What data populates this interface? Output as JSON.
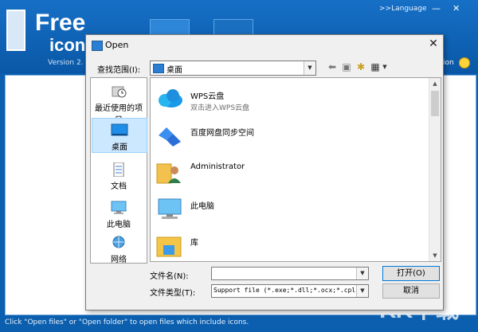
{
  "app": {
    "logo_line1": "Free",
    "logo_line2": "icon",
    "version": "Version 2.",
    "language": ">>Language",
    "right_text": "ation",
    "status": "Click \"Open files\" or \"Open folder\" to open files which include icons.",
    "watermark": "KK下载"
  },
  "dialog": {
    "title": "Open",
    "look_in_label": "查找范围(I):",
    "look_in_value": "桌面",
    "places": [
      {
        "label": "最近使用的项目",
        "icon": "recent-icon"
      },
      {
        "label": "桌面",
        "icon": "desktop-icon"
      },
      {
        "label": "文档",
        "icon": "documents-icon"
      },
      {
        "label": "此电脑",
        "icon": "computer-icon"
      },
      {
        "label": "网络",
        "icon": "network-icon"
      }
    ],
    "items": [
      {
        "name": "WPS云盘",
        "sub": "双击进入WPS云盘",
        "icon": "cloud-icon"
      },
      {
        "name": "百度网盘同步空间",
        "sub": "",
        "icon": "baidu-sync-icon"
      },
      {
        "name": "Administrator",
        "sub": "",
        "icon": "user-folder-icon"
      },
      {
        "name": "此电脑",
        "sub": "",
        "icon": "computer-icon"
      },
      {
        "name": "库",
        "sub": "",
        "icon": "library-icon"
      }
    ],
    "filename_label": "文件名(N):",
    "filename_value": "",
    "filetype_label": "文件类型(T):",
    "filetype_value": "Support file (*.exe;*.dll;*.ocx;*.cpl",
    "open_button": "打开(O)",
    "cancel_button": "取消"
  }
}
